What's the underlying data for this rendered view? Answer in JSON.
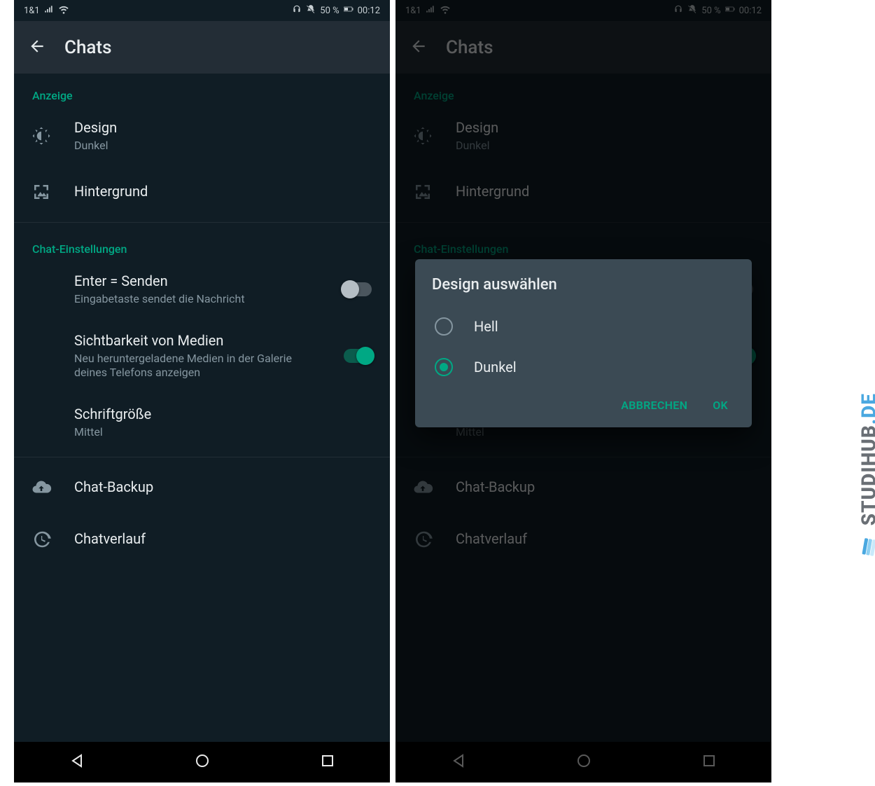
{
  "statusbar": {
    "carrier": "1&1",
    "battery_text": "50 %",
    "time": "00:12"
  },
  "appbar": {
    "title": "Chats"
  },
  "sections": {
    "display_label": "Anzeige",
    "chat_settings_label": "Chat-Einstellungen"
  },
  "rows": {
    "design": {
      "title": "Design",
      "subtitle": "Dunkel"
    },
    "wallpaper": {
      "title": "Hintergrund"
    },
    "enter_send": {
      "title": "Enter = Senden",
      "subtitle": "Eingabetaste sendet die Nachricht",
      "toggle": false
    },
    "media_visibility": {
      "title": "Sichtbarkeit von Medien",
      "subtitle": "Neu heruntergeladene Medien in der Galerie deines Telefons anzeigen",
      "toggle": true
    },
    "font_size": {
      "title": "Schriftgröße",
      "subtitle": "Mittel"
    },
    "chat_backup": {
      "title": "Chat-Backup"
    },
    "chat_history": {
      "title": "Chatverlauf"
    }
  },
  "dialog": {
    "title": "Design auswählen",
    "option_light": "Hell",
    "option_dark": "Dunkel",
    "selected": "Dunkel",
    "cancel": "ABBRECHEN",
    "ok": "OK"
  },
  "watermark": {
    "text_main": "STUDIHUB",
    "text_suffix": ".DE"
  }
}
